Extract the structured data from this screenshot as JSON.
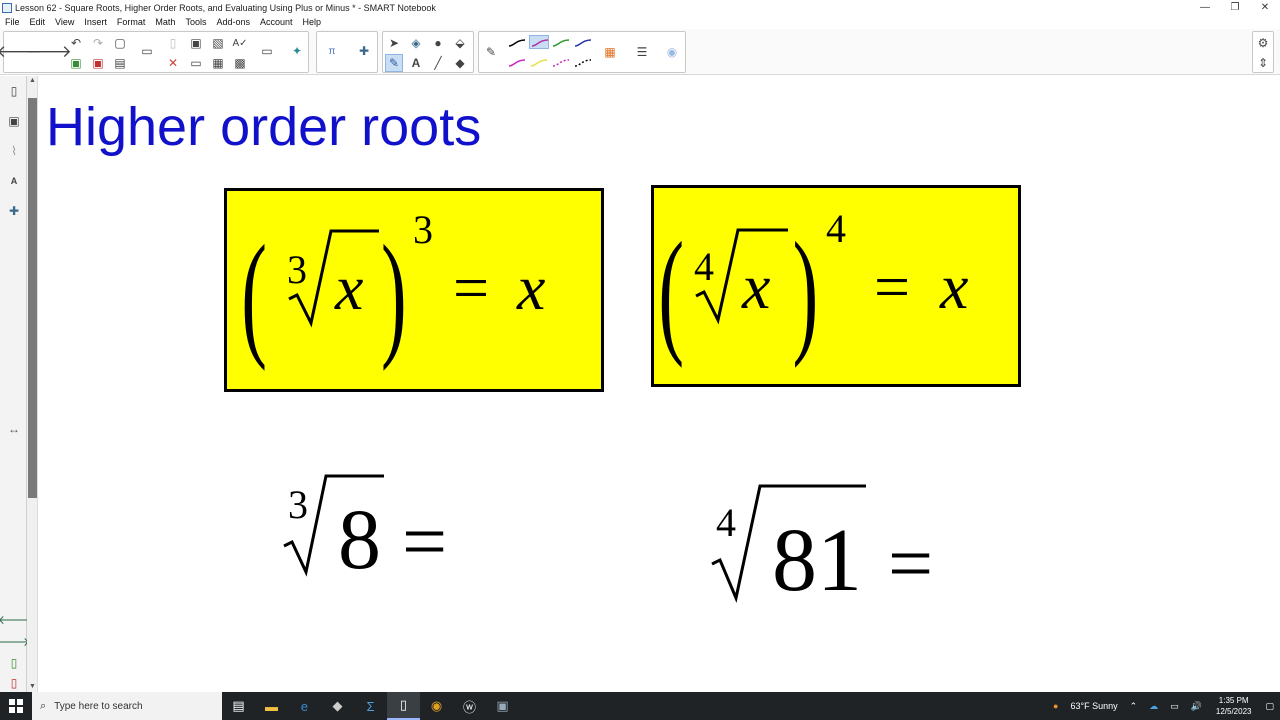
{
  "window": {
    "title": "Lesson 62 - Square Roots, Higher Order Roots, and Evaluating Using Plus or Minus * - SMART Notebook",
    "minimize": "—",
    "restore": "❐",
    "close": "✕"
  },
  "menu": [
    "File",
    "Edit",
    "View",
    "Insert",
    "Format",
    "Math",
    "Tools",
    "Add-ons",
    "Account",
    "Help"
  ],
  "page": {
    "title": "Higher order roots",
    "accent_color": "#1111cc",
    "box_color": "#ffff00",
    "formulas": [
      {
        "index": "3",
        "radicand": "x",
        "exponent": "3",
        "rhs": "x",
        "equals": "="
      },
      {
        "index": "4",
        "radicand": "x",
        "exponent": "4",
        "rhs": "x",
        "equals": "="
      }
    ],
    "problems": [
      {
        "index": "3",
        "radicand": "8",
        "equals": "="
      },
      {
        "index": "4",
        "radicand": "81",
        "equals": "="
      }
    ]
  },
  "taskbar": {
    "search_placeholder": "Type here to search",
    "weather": "63°F  Sunny",
    "time": "1:35 PM",
    "date": "12/5/2023"
  }
}
